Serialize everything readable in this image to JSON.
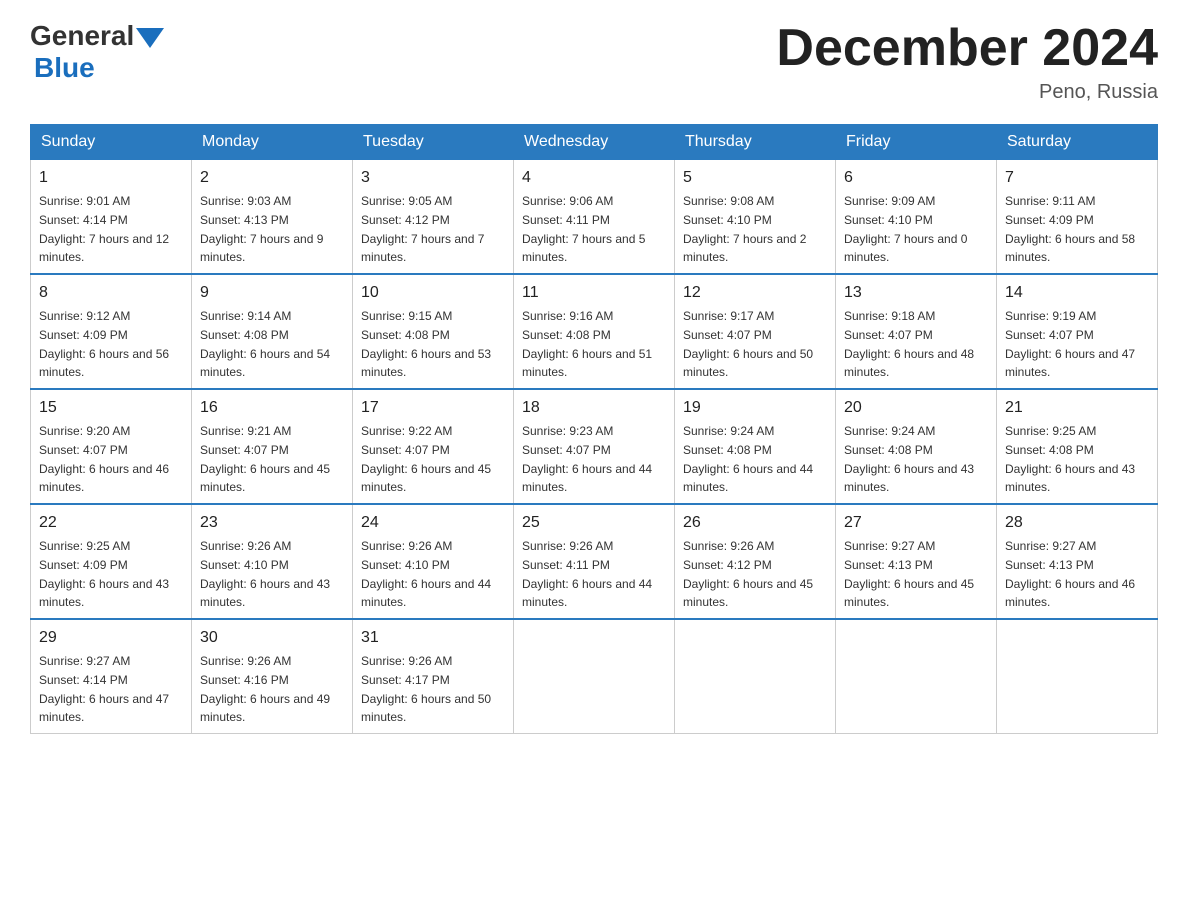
{
  "logo": {
    "general": "General",
    "blue": "Blue"
  },
  "title": "December 2024",
  "location": "Peno, Russia",
  "days_of_week": [
    "Sunday",
    "Monday",
    "Tuesday",
    "Wednesday",
    "Thursday",
    "Friday",
    "Saturday"
  ],
  "weeks": [
    [
      {
        "day": "1",
        "sunrise": "9:01 AM",
        "sunset": "4:14 PM",
        "daylight": "7 hours and 12 minutes."
      },
      {
        "day": "2",
        "sunrise": "9:03 AM",
        "sunset": "4:13 PM",
        "daylight": "7 hours and 9 minutes."
      },
      {
        "day": "3",
        "sunrise": "9:05 AM",
        "sunset": "4:12 PM",
        "daylight": "7 hours and 7 minutes."
      },
      {
        "day": "4",
        "sunrise": "9:06 AM",
        "sunset": "4:11 PM",
        "daylight": "7 hours and 5 minutes."
      },
      {
        "day": "5",
        "sunrise": "9:08 AM",
        "sunset": "4:10 PM",
        "daylight": "7 hours and 2 minutes."
      },
      {
        "day": "6",
        "sunrise": "9:09 AM",
        "sunset": "4:10 PM",
        "daylight": "7 hours and 0 minutes."
      },
      {
        "day": "7",
        "sunrise": "9:11 AM",
        "sunset": "4:09 PM",
        "daylight": "6 hours and 58 minutes."
      }
    ],
    [
      {
        "day": "8",
        "sunrise": "9:12 AM",
        "sunset": "4:09 PM",
        "daylight": "6 hours and 56 minutes."
      },
      {
        "day": "9",
        "sunrise": "9:14 AM",
        "sunset": "4:08 PM",
        "daylight": "6 hours and 54 minutes."
      },
      {
        "day": "10",
        "sunrise": "9:15 AM",
        "sunset": "4:08 PM",
        "daylight": "6 hours and 53 minutes."
      },
      {
        "day": "11",
        "sunrise": "9:16 AM",
        "sunset": "4:08 PM",
        "daylight": "6 hours and 51 minutes."
      },
      {
        "day": "12",
        "sunrise": "9:17 AM",
        "sunset": "4:07 PM",
        "daylight": "6 hours and 50 minutes."
      },
      {
        "day": "13",
        "sunrise": "9:18 AM",
        "sunset": "4:07 PM",
        "daylight": "6 hours and 48 minutes."
      },
      {
        "day": "14",
        "sunrise": "9:19 AM",
        "sunset": "4:07 PM",
        "daylight": "6 hours and 47 minutes."
      }
    ],
    [
      {
        "day": "15",
        "sunrise": "9:20 AM",
        "sunset": "4:07 PM",
        "daylight": "6 hours and 46 minutes."
      },
      {
        "day": "16",
        "sunrise": "9:21 AM",
        "sunset": "4:07 PM",
        "daylight": "6 hours and 45 minutes."
      },
      {
        "day": "17",
        "sunrise": "9:22 AM",
        "sunset": "4:07 PM",
        "daylight": "6 hours and 45 minutes."
      },
      {
        "day": "18",
        "sunrise": "9:23 AM",
        "sunset": "4:07 PM",
        "daylight": "6 hours and 44 minutes."
      },
      {
        "day": "19",
        "sunrise": "9:24 AM",
        "sunset": "4:08 PM",
        "daylight": "6 hours and 44 minutes."
      },
      {
        "day": "20",
        "sunrise": "9:24 AM",
        "sunset": "4:08 PM",
        "daylight": "6 hours and 43 minutes."
      },
      {
        "day": "21",
        "sunrise": "9:25 AM",
        "sunset": "4:08 PM",
        "daylight": "6 hours and 43 minutes."
      }
    ],
    [
      {
        "day": "22",
        "sunrise": "9:25 AM",
        "sunset": "4:09 PM",
        "daylight": "6 hours and 43 minutes."
      },
      {
        "day": "23",
        "sunrise": "9:26 AM",
        "sunset": "4:10 PM",
        "daylight": "6 hours and 43 minutes."
      },
      {
        "day": "24",
        "sunrise": "9:26 AM",
        "sunset": "4:10 PM",
        "daylight": "6 hours and 44 minutes."
      },
      {
        "day": "25",
        "sunrise": "9:26 AM",
        "sunset": "4:11 PM",
        "daylight": "6 hours and 44 minutes."
      },
      {
        "day": "26",
        "sunrise": "9:26 AM",
        "sunset": "4:12 PM",
        "daylight": "6 hours and 45 minutes."
      },
      {
        "day": "27",
        "sunrise": "9:27 AM",
        "sunset": "4:13 PM",
        "daylight": "6 hours and 45 minutes."
      },
      {
        "day": "28",
        "sunrise": "9:27 AM",
        "sunset": "4:13 PM",
        "daylight": "6 hours and 46 minutes."
      }
    ],
    [
      {
        "day": "29",
        "sunrise": "9:27 AM",
        "sunset": "4:14 PM",
        "daylight": "6 hours and 47 minutes."
      },
      {
        "day": "30",
        "sunrise": "9:26 AM",
        "sunset": "4:16 PM",
        "daylight": "6 hours and 49 minutes."
      },
      {
        "day": "31",
        "sunrise": "9:26 AM",
        "sunset": "4:17 PM",
        "daylight": "6 hours and 50 minutes."
      },
      null,
      null,
      null,
      null
    ]
  ]
}
